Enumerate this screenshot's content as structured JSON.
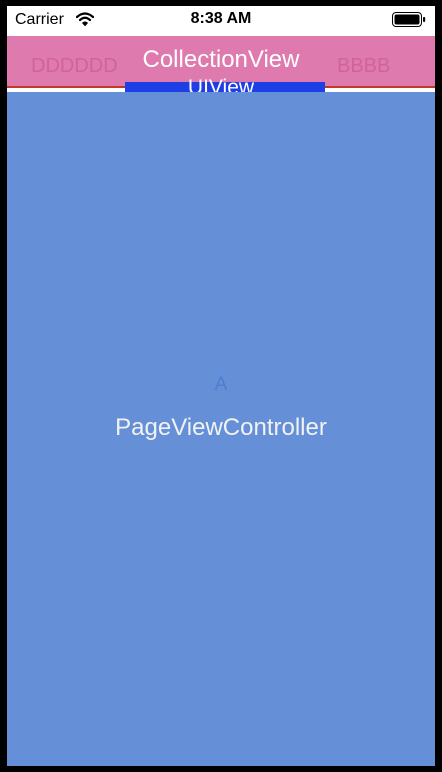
{
  "status_bar": {
    "carrier": "Carrier",
    "time": "8:38 AM",
    "icons": [
      "wifi-icon",
      "battery-icon"
    ]
  },
  "header": {
    "background": "#de7aae",
    "cells": [
      "DDDDDD",
      "BBBB"
    ],
    "collection_label": "CollectionView",
    "indicator_label": "UIView",
    "indicator_color": "#1f3fe6"
  },
  "page": {
    "background": "#658fd6",
    "letter": "A",
    "label": "PageViewController"
  }
}
